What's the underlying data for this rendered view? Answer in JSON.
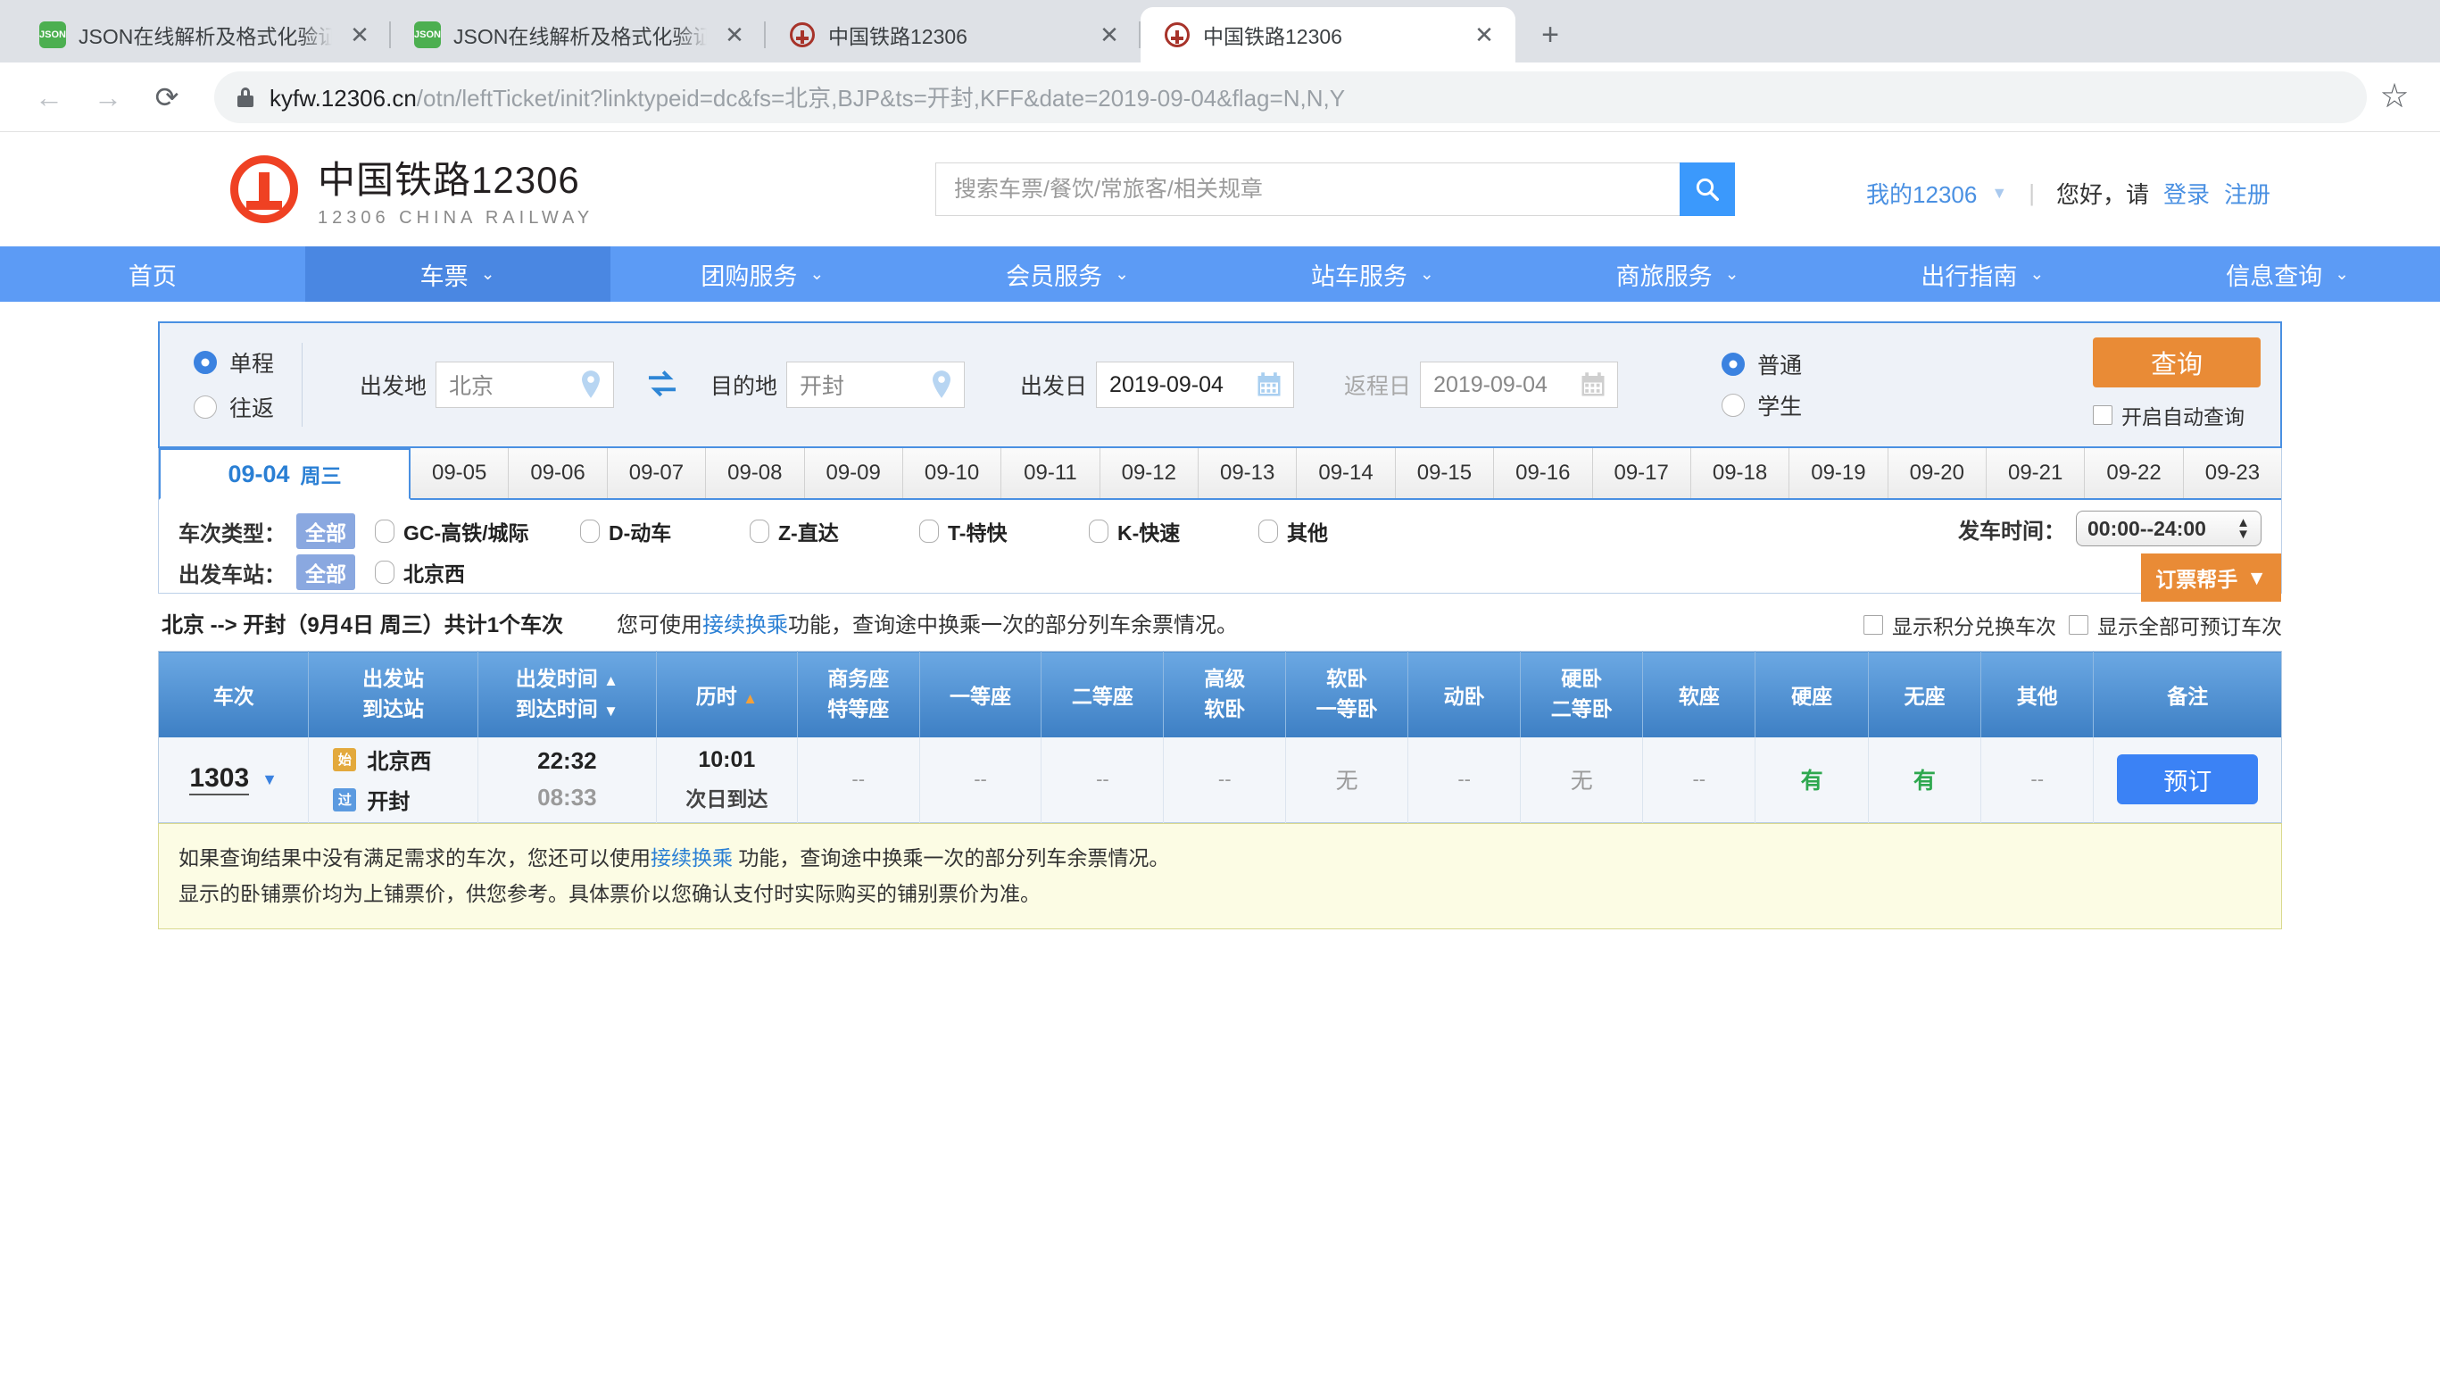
{
  "browser": {
    "tabs": [
      {
        "title": "JSON在线解析及格式化验证 - J",
        "favicon": "json-favicon",
        "active": false
      },
      {
        "title": "JSON在线解析及格式化验证 - J",
        "favicon": "json-favicon",
        "active": false
      },
      {
        "title": "中国铁路12306",
        "favicon": "railway-favicon",
        "active": false
      },
      {
        "title": "中国铁路12306",
        "favicon": "railway-favicon",
        "active": true
      }
    ],
    "new_tab_label": "+",
    "close_label": "✕",
    "back_label": "←",
    "forward_label": "→",
    "reload_label": "⟳",
    "bookmark_label": "☆",
    "url_host": "kyfw.12306.cn",
    "url_path": "/otn/leftTicket/init?linktypeid=dc&fs=北京,BJP&ts=开封,KFF&date=2019-09-04&flag=N,N,Y"
  },
  "header": {
    "logo_cn": "中国铁路12306",
    "logo_en": "12306 CHINA RAILWAY",
    "search_placeholder": "搜索车票/餐饮/常旅客/相关规章",
    "search_value": "",
    "my_account": "我的12306",
    "divider": "|",
    "greeting": "您好，请",
    "login": "登录",
    "register": "注册"
  },
  "nav": {
    "items": [
      {
        "label": "首页",
        "dropdown": false,
        "active": false
      },
      {
        "label": "车票",
        "dropdown": true,
        "active": true
      },
      {
        "label": "团购服务",
        "dropdown": true,
        "active": false
      },
      {
        "label": "会员服务",
        "dropdown": true,
        "active": false
      },
      {
        "label": "站车服务",
        "dropdown": true,
        "active": false
      },
      {
        "label": "商旅服务",
        "dropdown": true,
        "active": false
      },
      {
        "label": "出行指南",
        "dropdown": true,
        "active": false
      },
      {
        "label": "信息查询",
        "dropdown": true,
        "active": false
      }
    ],
    "caret": "⌄"
  },
  "query": {
    "trip_oneway": "单程",
    "trip_roundtrip": "往返",
    "trip_selected": "单程",
    "origin_label": "出发地",
    "origin_value": "北京",
    "dest_label": "目的地",
    "dest_value": "开封",
    "depart_date_label": "出发日",
    "depart_date_value": "2019-09-04",
    "return_date_label": "返程日",
    "return_date_value": "2019-09-04",
    "passenger_normal": "普通",
    "passenger_student": "学生",
    "passenger_selected": "普通",
    "query_button": "查询",
    "auto_query": "开启自动查询",
    "auto_query_checked": false
  },
  "dates": {
    "selected_index": 0,
    "tabs": [
      {
        "date": "09-04",
        "weekday": "周三"
      },
      {
        "date": "09-05",
        "weekday": ""
      },
      {
        "date": "09-06",
        "weekday": ""
      },
      {
        "date": "09-07",
        "weekday": ""
      },
      {
        "date": "09-08",
        "weekday": ""
      },
      {
        "date": "09-09",
        "weekday": ""
      },
      {
        "date": "09-10",
        "weekday": ""
      },
      {
        "date": "09-11",
        "weekday": ""
      },
      {
        "date": "09-12",
        "weekday": ""
      },
      {
        "date": "09-13",
        "weekday": ""
      },
      {
        "date": "09-14",
        "weekday": ""
      },
      {
        "date": "09-15",
        "weekday": ""
      },
      {
        "date": "09-16",
        "weekday": ""
      },
      {
        "date": "09-17",
        "weekday": ""
      },
      {
        "date": "09-18",
        "weekday": ""
      },
      {
        "date": "09-19",
        "weekday": ""
      },
      {
        "date": "09-20",
        "weekday": ""
      },
      {
        "date": "09-21",
        "weekday": ""
      },
      {
        "date": "09-22",
        "weekday": ""
      },
      {
        "date": "09-23",
        "weekday": ""
      }
    ]
  },
  "filters": {
    "train_type_label": "车次类型：",
    "all_pill": "全部",
    "train_types": [
      {
        "label": "GC-高铁/城际",
        "checked": false
      },
      {
        "label": "D-动车",
        "checked": false
      },
      {
        "label": "Z-直达",
        "checked": false
      },
      {
        "label": "T-特快",
        "checked": false
      },
      {
        "label": "K-快速",
        "checked": false
      },
      {
        "label": "其他",
        "checked": false
      }
    ],
    "station_label": "出发车站：",
    "stations": [
      {
        "label": "北京西",
        "checked": false
      }
    ],
    "depart_time_label": "发车时间：",
    "depart_time_value": "00:00--24:00",
    "helper_button": "订票帮手",
    "helper_caret": "▼"
  },
  "summary": {
    "route": "北京 --> 开封（9月4日 周三）共计1个车次",
    "tip_prefix": "您可使用",
    "tip_link": "接续换乘",
    "tip_suffix": "功能，查询途中换乘一次的部分列车余票情况。",
    "show_points_exchange": "显示积分兑换车次",
    "show_points_checked": false,
    "show_all_bookable": "显示全部可预订车次",
    "show_all_checked": false
  },
  "results": {
    "columns": [
      {
        "label": "车次",
        "sub": ""
      },
      {
        "label": "出发站",
        "sub": "到达站"
      },
      {
        "label": "出发时间",
        "sub": "到达时间",
        "sort_asc": "▲",
        "sort_desc": "▼"
      },
      {
        "label": "历时",
        "sub": "",
        "sort_orange": "▲"
      },
      {
        "label": "商务座",
        "sub": "特等座"
      },
      {
        "label": "一等座",
        "sub": ""
      },
      {
        "label": "二等座",
        "sub": ""
      },
      {
        "label": "高级",
        "sub": "软卧"
      },
      {
        "label": "软卧",
        "sub": "一等卧"
      },
      {
        "label": "动卧",
        "sub": ""
      },
      {
        "label": "硬卧",
        "sub": "二等卧"
      },
      {
        "label": "软座",
        "sub": ""
      },
      {
        "label": "硬座",
        "sub": ""
      },
      {
        "label": "无座",
        "sub": ""
      },
      {
        "label": "其他",
        "sub": ""
      },
      {
        "label": "备注",
        "sub": ""
      }
    ],
    "rows": [
      {
        "train_no": "1303",
        "from_station": "北京西",
        "to_station": "开封",
        "from_badge": "始",
        "to_badge": "过",
        "depart_time": "22:32",
        "arrive_time": "08:33",
        "duration": "10:01",
        "duration_note": "次日到达",
        "seats": {
          "business": "--",
          "first_class": "--",
          "second_class": "--",
          "premium_soft_sleeper": "--",
          "soft_sleeper": "无",
          "motor_sleeper": "--",
          "hard_sleeper": "无",
          "soft_seat": "--",
          "hard_seat": "有",
          "no_seat": "有",
          "other": "--"
        },
        "book_button": "预订"
      }
    ]
  },
  "notice": {
    "line1_prefix": "如果查询结果中没有满足需求的车次，您还可以使用",
    "line1_link": "接续换乘",
    "line1_suffix": " 功能，查询途中换乘一次的部分列车余票情况。",
    "line2": "显示的卧铺票价均为上铺票价，供您参考。具体票价以您确认支付时实际购买的铺别票价为准。"
  },
  "colors": {
    "brand_red": "#ef4123",
    "nav_blue": "#5c9bf5",
    "accent_orange": "#e98b36",
    "link_blue": "#2a7fd4",
    "available_green": "#2ea84f"
  }
}
